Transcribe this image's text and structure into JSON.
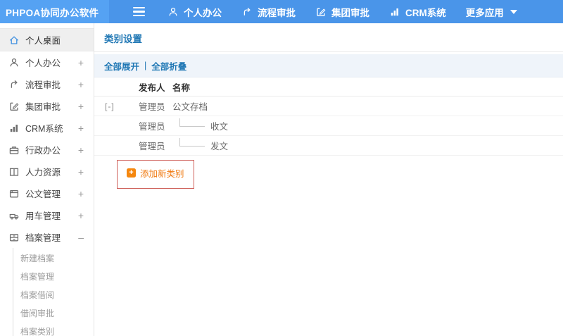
{
  "header": {
    "logo": "PHPOA协同办公软件",
    "nav": [
      {
        "label": "个人办公",
        "icon": "user-icon"
      },
      {
        "label": "流程审批",
        "icon": "flow-icon"
      },
      {
        "label": "集团审批",
        "icon": "edit-icon"
      },
      {
        "label": "CRM系统",
        "icon": "chart-icon"
      },
      {
        "label": "更多应用",
        "icon": "caret-down-icon"
      }
    ]
  },
  "sidebar": {
    "items": [
      {
        "label": "个人桌面",
        "icon": "home-icon",
        "suffix": "",
        "active": true
      },
      {
        "label": "个人办公",
        "icon": "user-icon",
        "suffix": "+"
      },
      {
        "label": "流程审批",
        "icon": "flow-icon",
        "suffix": "+"
      },
      {
        "label": "集团审批",
        "icon": "edit-icon",
        "suffix": "+"
      },
      {
        "label": "CRM系统",
        "icon": "chart-icon",
        "suffix": "+"
      },
      {
        "label": "行政办公",
        "icon": "briefcase-icon",
        "suffix": "+"
      },
      {
        "label": "人力资源",
        "icon": "book-icon",
        "suffix": "+"
      },
      {
        "label": "公文管理",
        "icon": "document-icon",
        "suffix": "+"
      },
      {
        "label": "用车管理",
        "icon": "car-icon",
        "suffix": "+"
      },
      {
        "label": "档案管理",
        "icon": "archive-icon",
        "suffix": "–",
        "expanded": true
      }
    ],
    "subitems": [
      "新建档案",
      "档案管理",
      "档案借阅",
      "借阅审批",
      "档案类别"
    ]
  },
  "main": {
    "title": "类别设置",
    "toolbar": {
      "expand_all": "全部展开",
      "separator": "|",
      "collapse_all": "全部折叠"
    },
    "table": {
      "headers": {
        "publisher": "发布人",
        "name": "名称"
      },
      "rows": [
        {
          "toggle": "[-]",
          "publisher": "管理员",
          "name": "公文存档",
          "child": false
        },
        {
          "toggle": "",
          "publisher": "管理员",
          "name": "收文",
          "child": true
        },
        {
          "toggle": "",
          "publisher": "管理员",
          "name": "发文",
          "child": true
        }
      ]
    },
    "add_button": {
      "label": "添加新类别"
    }
  },
  "colors": {
    "header_blue": "#4a95e9",
    "logo_blue": "#55a2f3",
    "link_blue": "#2178b5",
    "toolbar_bg": "#eff4fa",
    "orange_accent": "#f5870f",
    "orange_text": "#f07a12",
    "annotation_red": "#cf625c"
  }
}
